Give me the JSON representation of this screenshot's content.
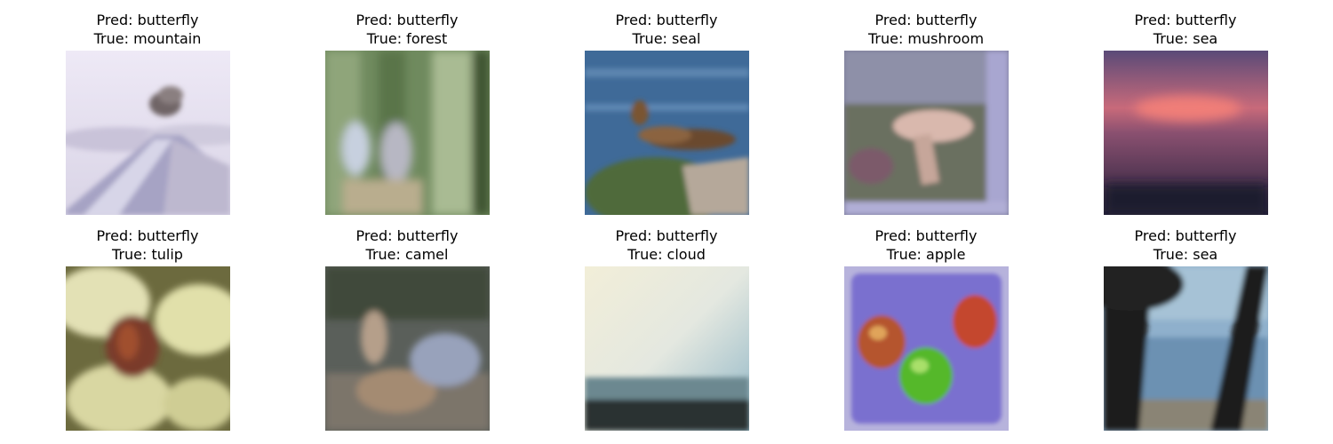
{
  "panels": [
    {
      "pred": "Pred: butterfly",
      "true": "True: mountain",
      "scene": "mountain"
    },
    {
      "pred": "Pred: butterfly",
      "true": "True: forest",
      "scene": "forest"
    },
    {
      "pred": "Pred: butterfly",
      "true": "True: seal",
      "scene": "seal"
    },
    {
      "pred": "Pred: butterfly",
      "true": "True: mushroom",
      "scene": "mushroom"
    },
    {
      "pred": "Pred: butterfly",
      "true": "True: sea",
      "scene": "sea-sunset"
    },
    {
      "pred": "Pred: butterfly",
      "true": "True: tulip",
      "scene": "tulip"
    },
    {
      "pred": "Pred: butterfly",
      "true": "True: camel",
      "scene": "camel"
    },
    {
      "pred": "Pred: butterfly",
      "true": "True: cloud",
      "scene": "cloud"
    },
    {
      "pred": "Pred: butterfly",
      "true": "True: apple",
      "scene": "apple"
    },
    {
      "pred": "Pred: butterfly",
      "true": "True: sea",
      "scene": "sea-trees"
    }
  ]
}
